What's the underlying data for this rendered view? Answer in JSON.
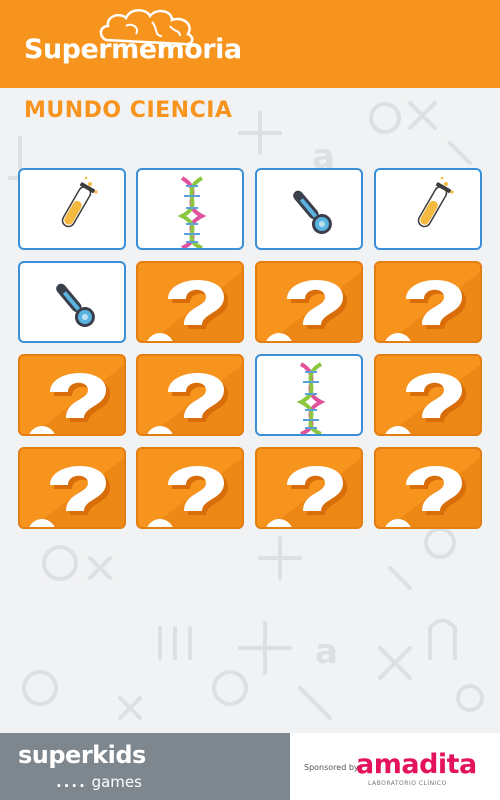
{
  "header": {
    "logo_text": "Supermemoria",
    "subtitle": "MUNDO CIENCIA"
  },
  "board": {
    "rows": 4,
    "cols": 4,
    "cards": [
      {
        "state": "revealed",
        "icon": "test-tube-icon"
      },
      {
        "state": "revealed",
        "icon": "dna-icon"
      },
      {
        "state": "revealed",
        "icon": "thermometer-icon"
      },
      {
        "state": "revealed",
        "icon": "test-tube-icon"
      },
      {
        "state": "revealed",
        "icon": "thermometer-icon"
      },
      {
        "state": "hidden",
        "icon": "question-mark-icon"
      },
      {
        "state": "hidden",
        "icon": "question-mark-icon"
      },
      {
        "state": "hidden",
        "icon": "question-mark-icon"
      },
      {
        "state": "hidden",
        "icon": "question-mark-icon"
      },
      {
        "state": "hidden",
        "icon": "question-mark-icon"
      },
      {
        "state": "revealed",
        "icon": "dna-icon"
      },
      {
        "state": "hidden",
        "icon": "question-mark-icon"
      },
      {
        "state": "hidden",
        "icon": "question-mark-icon"
      },
      {
        "state": "hidden",
        "icon": "question-mark-icon"
      },
      {
        "state": "hidden",
        "icon": "question-mark-icon"
      },
      {
        "state": "hidden",
        "icon": "question-mark-icon"
      }
    ]
  },
  "footer": {
    "left_logo_text": "superkids",
    "left_logo_dots": "....",
    "left_logo_sub": "games",
    "sponsored_text": "Sponsored by",
    "sponsor_name": "amadita",
    "sponsor_sub": "LABORATORIO CLÍNICO"
  },
  "colors": {
    "orange": "#f7941e",
    "card_border_blue": "#3a8fd6",
    "sponsor_pink": "#e4115d",
    "footer_grey": "#7e868e"
  }
}
